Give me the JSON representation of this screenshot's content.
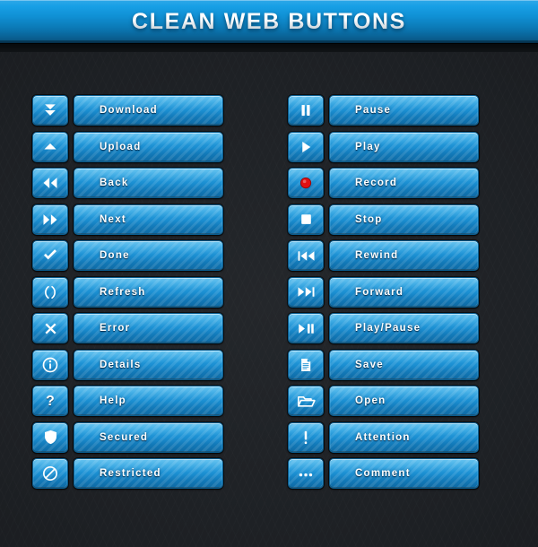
{
  "header": {
    "title": "CLEAN WEB BUTTONS",
    "background_top": "#2fa8e8",
    "background_bottom": "#0a4f78",
    "title_color": "#ffffff"
  },
  "theme": {
    "page_background": "#1e2125",
    "button_top": "#3fb4ec",
    "button_bottom": "#0e6aa4",
    "button_border": "#0a5c8e",
    "icon_color": "#ffffff",
    "label_color": "#ffffff",
    "record_accent": "#e00f12"
  },
  "columns": [
    {
      "name": "left-column",
      "buttons": [
        {
          "label": "Download",
          "icon": "download-icon"
        },
        {
          "label": "Upload",
          "icon": "upload-icon"
        },
        {
          "label": "Back",
          "icon": "back-icon"
        },
        {
          "label": "Next",
          "icon": "next-icon"
        },
        {
          "label": "Done",
          "icon": "check-icon"
        },
        {
          "label": "Refresh",
          "icon": "refresh-icon"
        },
        {
          "label": "Error",
          "icon": "close-x-icon"
        },
        {
          "label": "Details",
          "icon": "info-icon"
        },
        {
          "label": "Help",
          "icon": "question-mark-icon"
        },
        {
          "label": "Secured",
          "icon": "shield-icon"
        },
        {
          "label": "Restricted",
          "icon": "no-entry-icon"
        }
      ]
    },
    {
      "name": "right-column",
      "buttons": [
        {
          "label": "Pause",
          "icon": "pause-icon"
        },
        {
          "label": "Play",
          "icon": "play-icon"
        },
        {
          "label": "Record",
          "icon": "record-icon"
        },
        {
          "label": "Stop",
          "icon": "stop-icon"
        },
        {
          "label": "Rewind",
          "icon": "rewind-icon"
        },
        {
          "label": "Forward",
          "icon": "forward-icon"
        },
        {
          "label": "Play/Pause",
          "icon": "play-pause-icon"
        },
        {
          "label": "Save",
          "icon": "document-icon"
        },
        {
          "label": "Open",
          "icon": "folder-icon"
        },
        {
          "label": "Attention",
          "icon": "exclamation-icon"
        },
        {
          "label": "Comment",
          "icon": "ellipsis-icon"
        }
      ]
    }
  ]
}
